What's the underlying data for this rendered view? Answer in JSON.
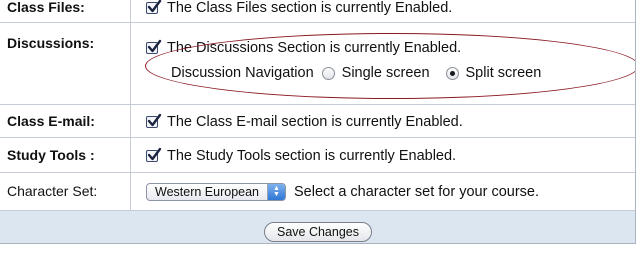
{
  "rows": {
    "class_files": {
      "label": "Class Files:",
      "text": "The Class Files section is currently Enabled."
    },
    "discussions": {
      "label": "Discussions:",
      "text": "The Discussions Section is currently Enabled.",
      "nav_label": "Discussion Navigation",
      "option_single": "Single screen",
      "option_split": "Split screen",
      "selected": "Split screen"
    },
    "class_email": {
      "label": "Class E-mail:",
      "text": "The Class E-mail section is currently Enabled."
    },
    "study_tools": {
      "label": "Study Tools :",
      "text": "The Study Tools section is currently Enabled."
    },
    "character_set": {
      "label": "Character Set:",
      "selected_value": "Western European",
      "help_text": "Select a character set for your course."
    }
  },
  "footer": {
    "save_label": "Save Changes"
  },
  "colors": {
    "footer_bg": "#dce6f1",
    "annotation": "#8a1a22",
    "grid": "#c5ccd6"
  }
}
